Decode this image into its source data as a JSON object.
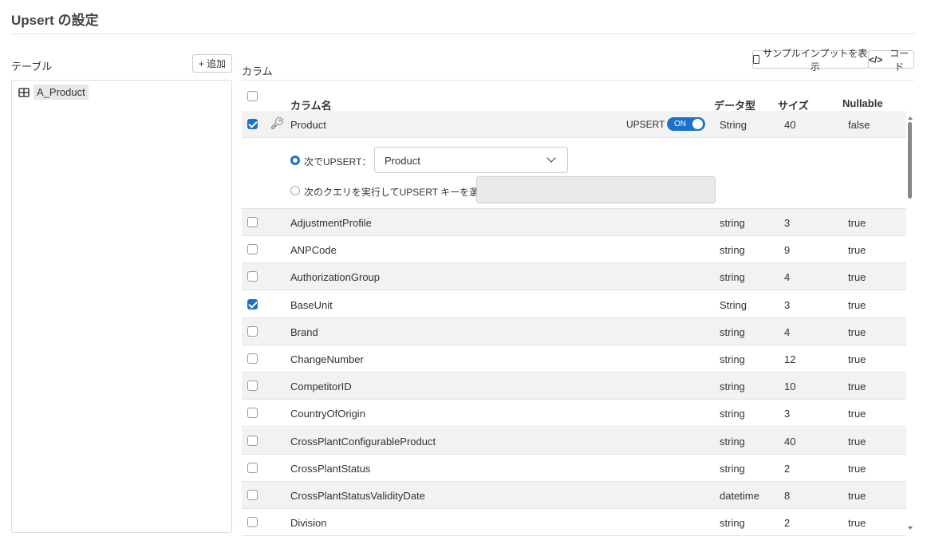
{
  "title": "Upsert の設定",
  "left": {
    "label": "テーブル",
    "add_button": "+ 追加",
    "tables": [
      "A_Product"
    ]
  },
  "columns": {
    "label": "カラム",
    "sample_button": "サンプルインプットを表示",
    "code_button": "コード",
    "headers": {
      "name": "カラム名",
      "type": "データ型",
      "size": "サイズ",
      "nullable": "Nullable"
    },
    "key_row": {
      "name": "Product",
      "upsert_label": "UPSERT",
      "toggle": "ON",
      "type": "String",
      "size": "40",
      "nullable": "false",
      "checked": true
    },
    "upsert_by_label": "次でUPSERT：",
    "upsert_by_value": "Product",
    "query_label": "次のクエリを実行してUPSERT キーを選択",
    "rows": [
      {
        "name": "AdjustmentProfile",
        "type": "string",
        "size": "3",
        "nullable": "true",
        "checked": false
      },
      {
        "name": "ANPCode",
        "type": "string",
        "size": "9",
        "nullable": "true",
        "checked": false
      },
      {
        "name": "AuthorizationGroup",
        "type": "string",
        "size": "4",
        "nullable": "true",
        "checked": false
      },
      {
        "name": "BaseUnit",
        "type": "String",
        "size": "3",
        "nullable": "true",
        "checked": true
      },
      {
        "name": "Brand",
        "type": "string",
        "size": "4",
        "nullable": "true",
        "checked": false
      },
      {
        "name": "ChangeNumber",
        "type": "string",
        "size": "12",
        "nullable": "true",
        "checked": false
      },
      {
        "name": "CompetitorID",
        "type": "string",
        "size": "10",
        "nullable": "true",
        "checked": false
      },
      {
        "name": "CountryOfOrigin",
        "type": "string",
        "size": "3",
        "nullable": "true",
        "checked": false
      },
      {
        "name": "CrossPlantConfigurableProduct",
        "type": "string",
        "size": "40",
        "nullable": "true",
        "checked": false
      },
      {
        "name": "CrossPlantStatus",
        "type": "string",
        "size": "2",
        "nullable": "true",
        "checked": false
      },
      {
        "name": "CrossPlantStatusValidityDate",
        "type": "datetime",
        "size": "8",
        "nullable": "true",
        "checked": false
      },
      {
        "name": "Division",
        "type": "string",
        "size": "2",
        "nullable": "true",
        "checked": false
      }
    ]
  }
}
